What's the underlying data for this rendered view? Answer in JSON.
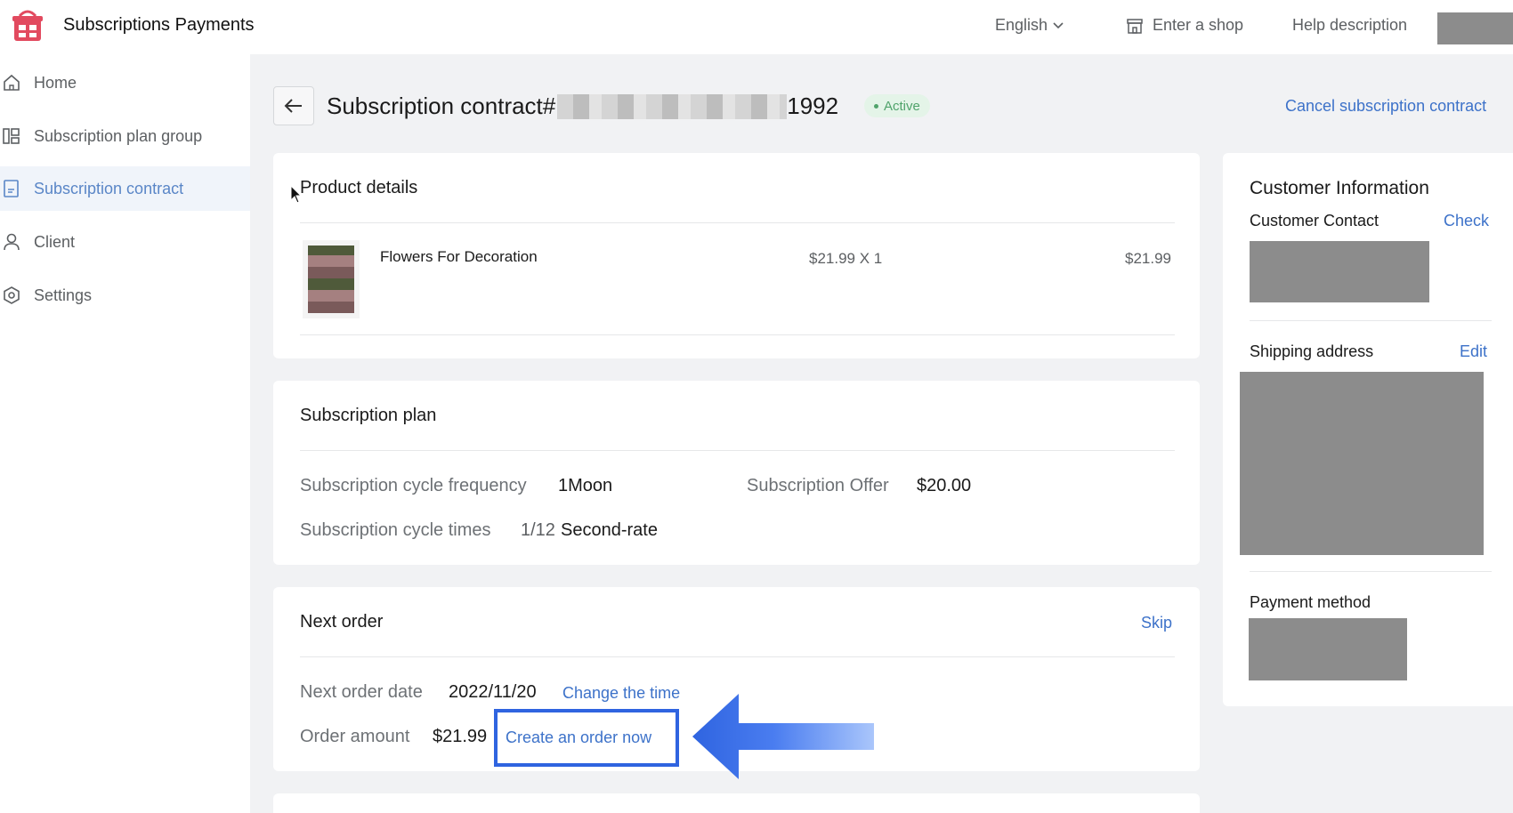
{
  "header": {
    "app_title": "Subscriptions Payments",
    "language": "English",
    "enter_shop": "Enter a shop",
    "help": "Help description"
  },
  "sidebar": {
    "items": [
      {
        "label": "Home",
        "icon": "home-icon"
      },
      {
        "label": "Subscription plan group",
        "icon": "plan-group-icon"
      },
      {
        "label": "Subscription contract",
        "icon": "contract-icon",
        "active": true
      },
      {
        "label": "Client",
        "icon": "user-icon"
      },
      {
        "label": "Settings",
        "icon": "settings-icon"
      }
    ]
  },
  "page": {
    "title_prefix": "Subscription contract#",
    "title_suffix": "1992",
    "status": "Active",
    "cancel_link": "Cancel subscription contract"
  },
  "product_details": {
    "title": "Product details",
    "product_name": "Flowers For Decoration",
    "quantity_text": "$21.99 X 1",
    "total": "$21.99"
  },
  "subscription_plan": {
    "title": "Subscription plan",
    "cycle_frequency_label": "Subscription cycle frequency",
    "cycle_frequency_value": "1Moon",
    "offer_label": "Subscription Offer",
    "offer_value": "$20.00",
    "cycle_times_label": "Subscription cycle times",
    "cycle_times_value": "1/12",
    "cycle_times_rate": "Second-rate"
  },
  "next_order": {
    "title": "Next order",
    "skip": "Skip",
    "date_label": "Next order date",
    "date_value": "2022/11/20",
    "change_time": "Change the time",
    "amount_label": "Order amount",
    "amount_value": "$21.99",
    "create_order": "Create an order now"
  },
  "customer_info": {
    "title": "Customer Information",
    "contact_label": "Customer Contact",
    "check": "Check",
    "shipping_label": "Shipping address",
    "edit": "Edit",
    "payment_label": "Payment method"
  },
  "colors": {
    "accent": "#3d72c9",
    "active_bg": "#f0f4fa",
    "status_green": "#50a36b",
    "highlight": "#2f64e0"
  }
}
